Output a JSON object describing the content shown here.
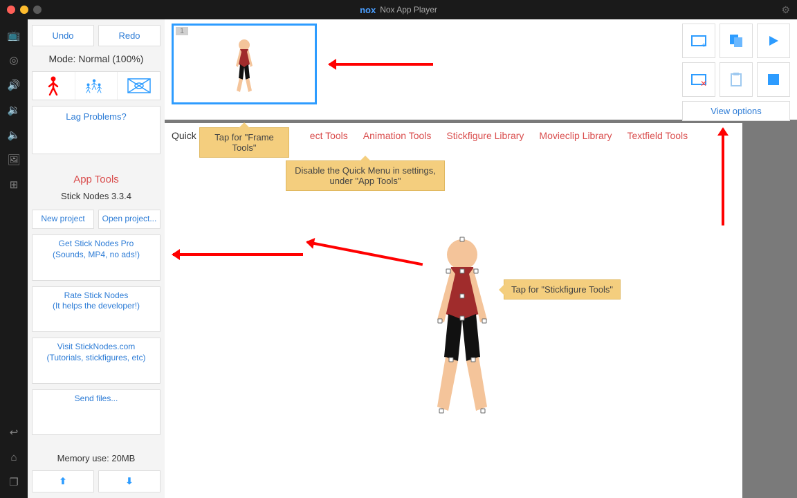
{
  "window": {
    "title": "Nox App Player",
    "brand": "nox"
  },
  "left": {
    "undo": "Undo",
    "redo": "Redo",
    "mode": "Mode: Normal (100%)",
    "lag": "Lag Problems?",
    "appToolsHdr": "App Tools",
    "version": "Stick Nodes 3.3.4",
    "newProject": "New project",
    "openProject": "Open project...",
    "getPro": "Get Stick Nodes Pro\n(Sounds, MP4, no ads!)",
    "rate": "Rate Stick Nodes\n(It helps the developer!)",
    "visit": "Visit StickNodes.com\n(Tutorials, stickfigures, etc)",
    "send": "Send files...",
    "memory": "Memory use: 20MB"
  },
  "quickMenu": {
    "first": "Quick",
    "items": [
      "ect Tools",
      "Animation Tools",
      "Stickfigure Library",
      "Movieclip Library",
      "Textfield Tools"
    ]
  },
  "tips": {
    "frame": "Tap for \"Frame Tools\"",
    "disable": "Disable the Quick Menu in settings, under \"App Tools\"",
    "stick": "Tap for \"Stickfigure Tools\""
  },
  "right": {
    "viewOptions": "View options"
  },
  "frame": {
    "number": "1"
  }
}
